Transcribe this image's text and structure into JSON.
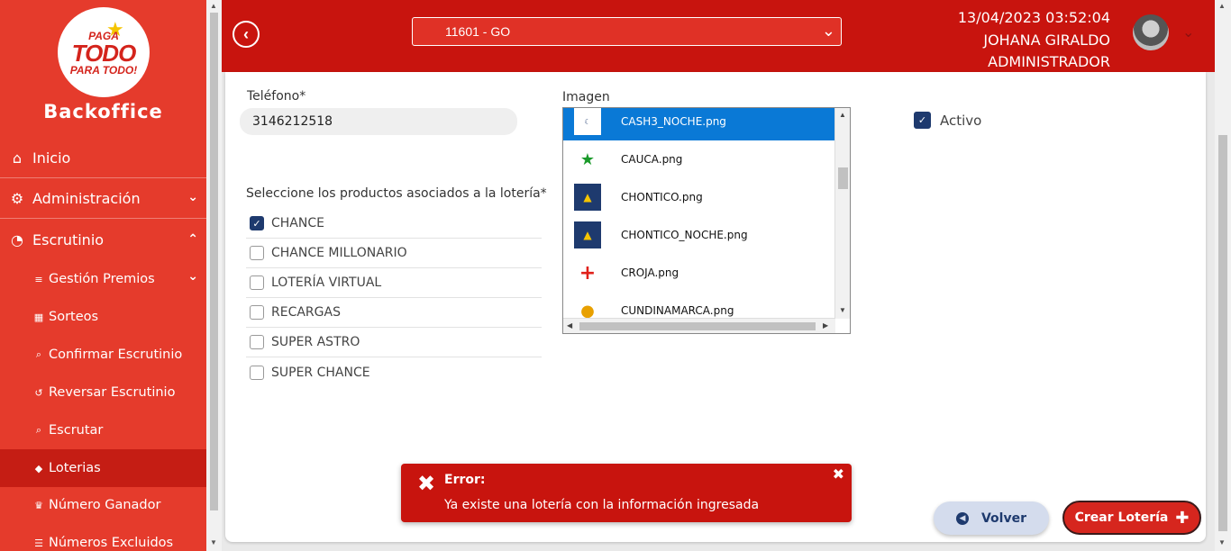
{
  "sidebar": {
    "logo": {
      "line1": "PAGA",
      "line2": "TODO",
      "line3": "PARA TODO!"
    },
    "brand": "Backoffice",
    "items": [
      {
        "label": "Inicio",
        "icon": "home-icon"
      },
      {
        "label": "Administración",
        "icon": "gear-icon"
      },
      {
        "label": "Escrutinio",
        "icon": "pie-chart-icon"
      }
    ],
    "subitems": [
      {
        "label": "Gestión Premios",
        "icon": "sliders-icon"
      },
      {
        "label": "Sorteos",
        "icon": "calendar-icon"
      },
      {
        "label": "Confirmar Escrutinio",
        "icon": "search-icon"
      },
      {
        "label": "Reversar Escrutinio",
        "icon": "undo-icon"
      },
      {
        "label": "Escrutar",
        "icon": "search-icon"
      },
      {
        "label": "Loterias",
        "icon": "ticket-icon",
        "active": true
      },
      {
        "label": "Número Ganador",
        "icon": "trophy-icon"
      },
      {
        "label": "Números Excluidos",
        "icon": "list-icon"
      }
    ]
  },
  "header": {
    "branch": "11601 - GO",
    "datetime": "13/04/2023 03:52:04",
    "user_name": "JOHANA GIRALDO",
    "user_role": "ADMINISTRADOR"
  },
  "form": {
    "phone_label": "Teléfono*",
    "phone_value": "3146212518",
    "products_label": "Seleccione los productos asociados a la lotería*",
    "products": [
      {
        "label": "CHANCE",
        "checked": true
      },
      {
        "label": "CHANCE MILLONARIO",
        "checked": false
      },
      {
        "label": "LOTERÍA VIRTUAL",
        "checked": false
      },
      {
        "label": "RECARGAS",
        "checked": false
      },
      {
        "label": "SUPER ASTRO",
        "checked": false
      },
      {
        "label": "SUPER CHANCE",
        "checked": false
      }
    ],
    "image_label": "Imagen",
    "images": [
      {
        "name": "CASH3_NOCHE.png",
        "selected": true
      },
      {
        "name": "CAUCA.png",
        "selected": false
      },
      {
        "name": "CHONTICO.png",
        "selected": false
      },
      {
        "name": "CHONTICO_NOCHE.png",
        "selected": false
      },
      {
        "name": "CROJA.png",
        "selected": false
      },
      {
        "name": "CUNDINAMARCA.png",
        "selected": false
      }
    ],
    "active_label": "Activo",
    "active_checked": true
  },
  "toast": {
    "title": "Error:",
    "message": "Ya existe una lotería con la información ingresada"
  },
  "buttons": {
    "back": "Volver",
    "create": "Crear Lotería"
  },
  "colors": {
    "sidebar": "#e53b2c",
    "header": "#c8140e",
    "active_item": "#c51d14",
    "selection_blue": "#0a79d6",
    "check_navy": "#1e3a6e"
  }
}
